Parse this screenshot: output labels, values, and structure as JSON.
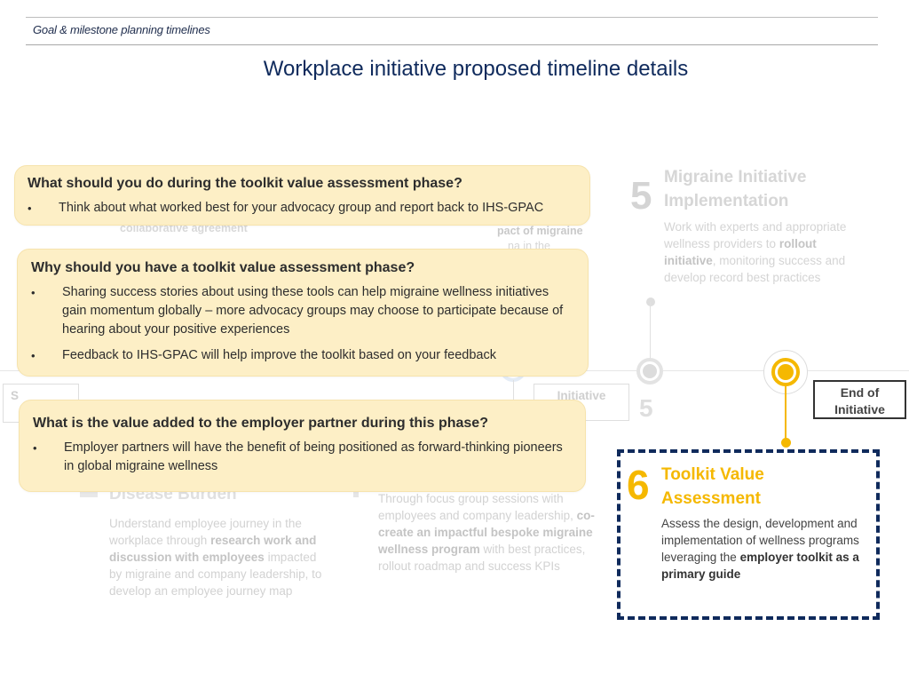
{
  "header": {
    "breadcrumb": "Goal & milestone planning timelines",
    "title": "Workplace initiative proposed timeline details"
  },
  "background_timeline": {
    "step5": {
      "number": "5",
      "number_secondary": "5",
      "title_line1": "Migraine Initiative",
      "title_line2": "Implementation",
      "desc_before": "Work with experts and appropriate wellness providers to ",
      "desc_bold": "rollout initiative",
      "desc_after": ", monitoring success and develop record best practices"
    },
    "step1": {
      "title": "Disease Burden",
      "desc_before": "Understand employee journey in the workplace through ",
      "desc_bold": "research work and discussion with employees",
      "desc_after": " impacted by migraine and company leadership, to develop an employee journey map"
    },
    "step2": {
      "desc_before": "Through focus group sessions with employees and company leadership, ",
      "desc_bold": "co-create an impactful bespoke migraine wellness program",
      "desc_after": " with best practices, rollout roadmap and success KPIs"
    },
    "fragments": {
      "left_bold": "collaborative agreement",
      "right_bold": "pact of migraine",
      "right_tail": "na in the"
    },
    "initiative_box": "Initiative",
    "start_box_letter": "S"
  },
  "callouts": [
    {
      "heading": "What should you do during the toolkit value assessment phase?",
      "bullets": [
        "Think about what worked best for your advocacy group and report back to IHS-GPAC"
      ]
    },
    {
      "heading": "Why should you have a toolkit value assessment phase?",
      "bullets": [
        "Sharing success stories about using these tools can help migraine wellness initiatives gain momentum globally – more advocacy groups may choose to participate because of hearing about your positive experiences",
        "Feedback to IHS-GPAC will help improve the toolkit based on your feedback"
      ]
    },
    {
      "heading": "What is the value added to the employer partner during this phase?",
      "bullets": [
        "Employer partners will have the benefit of being positioned as forward-thinking pioneers in global migraine wellness"
      ]
    }
  ],
  "end_marker": {
    "line1": "End of",
    "line2": "Initiative"
  },
  "active_step": {
    "number": "6",
    "title_line1": "Toolkit Value",
    "title_line2": "Assessment",
    "desc_before": "Assess the design, development and implementation of wellness programs leveraging the ",
    "desc_bold": "employer toolkit as a primary guide",
    "accent_color": "#f5b800",
    "frame_color": "#0f2a5c"
  }
}
